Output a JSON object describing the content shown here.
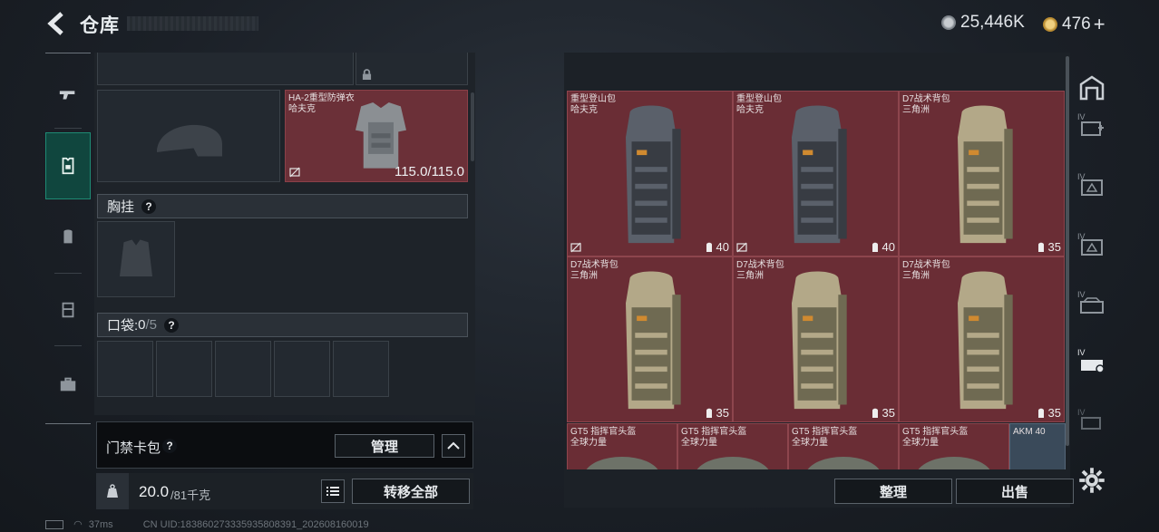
{
  "header": {
    "title": "仓库",
    "currency_silver": "25,446K",
    "currency_gold": "476",
    "plus": "+"
  },
  "left_tabs": [
    {
      "name": "weapon"
    },
    {
      "name": "equipment",
      "active": true
    },
    {
      "name": "backpack"
    },
    {
      "name": "rig"
    },
    {
      "name": "case"
    }
  ],
  "armor": {
    "name": "HA-2重型防弹衣",
    "maker": "哈夫克",
    "durability": "115.0/115.0"
  },
  "chest_rig": {
    "label": "胸挂",
    "help": "?"
  },
  "pockets": {
    "label": "口袋: ",
    "used": "0",
    "total": "/5",
    "help": "?"
  },
  "keycard": {
    "label": "门禁卡包",
    "help": "?",
    "manage_label": "管理"
  },
  "weight": {
    "current": "20.0",
    "limit": "/81千克",
    "transfer_label": "转移全部"
  },
  "stash_items": [
    {
      "name": "重型登山包",
      "maker": "哈夫克",
      "capacity": "40",
      "color": "gray",
      "tag": true
    },
    {
      "name": "重型登山包",
      "maker": "哈夫克",
      "capacity": "40",
      "color": "gray",
      "tag": true
    },
    {
      "name": "D7战术背包",
      "maker": "三角洲",
      "capacity": "35",
      "color": "tan",
      "tag": false
    },
    {
      "name": "D7战术背包",
      "maker": "三角洲",
      "capacity": "35",
      "color": "tan",
      "tag": false
    },
    {
      "name": "D7战术背包",
      "maker": "三角洲",
      "capacity": "35",
      "color": "tan",
      "tag": false
    },
    {
      "name": "D7战术背包",
      "maker": "三角洲",
      "capacity": "35",
      "color": "tan",
      "tag": false
    }
  ],
  "stash_helmets": [
    {
      "name": "GT5 指挥官头盔",
      "maker": "全球力量"
    },
    {
      "name": "GT5 指挥官头盔",
      "maker": "全球力量"
    },
    {
      "name": "GT5 指挥官头盔",
      "maker": "全球力量"
    },
    {
      "name": "GT5 指挥官头盔",
      "maker": "全球力量"
    }
  ],
  "stash_weapon": {
    "name": "AKM 40"
  },
  "right_side_tiers": [
    "IV",
    "IV",
    "IV",
    "IV",
    "IV",
    "IV"
  ],
  "bottom_buttons": {
    "sort_label": "整理",
    "sell_label": "出售"
  },
  "status_bar": {
    "ping": "37ms",
    "uid": "CN UID:183860273335935808391_202608160019"
  },
  "colors": {
    "item_bg": "#6a2d35",
    "active_tab": "#10463e",
    "gold": "#c9a14a",
    "silver": "#9aa0a6"
  }
}
